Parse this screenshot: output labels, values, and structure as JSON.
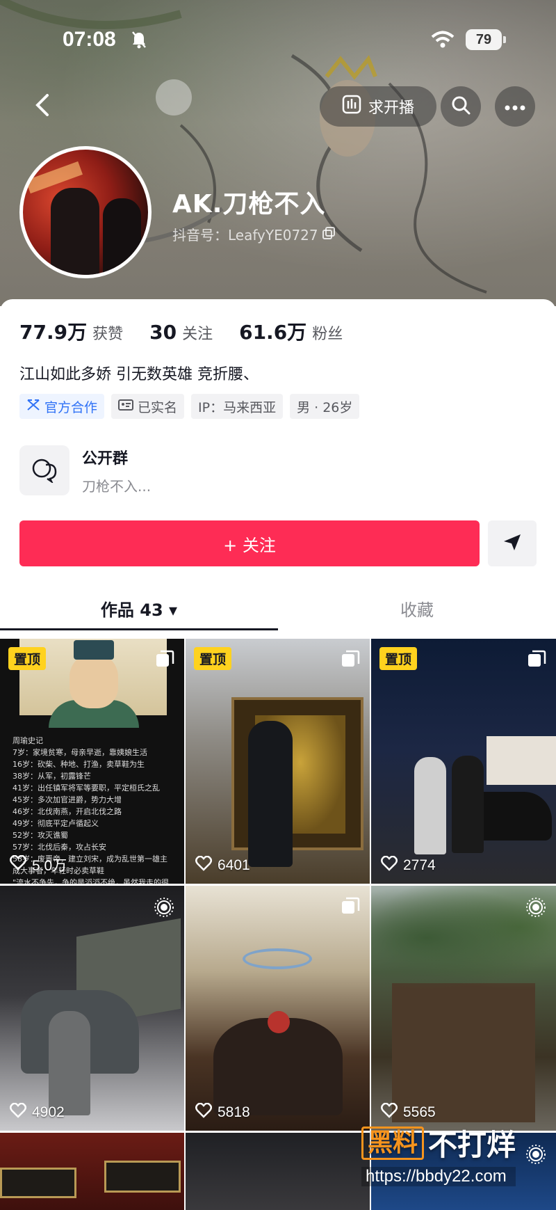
{
  "status_bar": {
    "time": "07:08",
    "battery": "79"
  },
  "header": {
    "live_request_label": "求开播"
  },
  "profile": {
    "name": "AK.刀枪不入",
    "douyin_id": "抖音号：LeafyYE0727",
    "stats": [
      {
        "value": "77.9万",
        "label": "获赞"
      },
      {
        "value": "30",
        "label": "关注"
      },
      {
        "value": "61.6万",
        "label": "粉丝"
      }
    ],
    "bio": "江山如此多娇 引无数英雄 竞折腰、",
    "tags": [
      {
        "text": "官方合作"
      },
      {
        "text": "已实名"
      },
      {
        "text": "IP：马来西亚"
      },
      {
        "text": "男 · 26岁"
      }
    ],
    "group": {
      "title": "公开群",
      "subtitle": "刀枪不入..."
    },
    "follow_label": "+ 关注"
  },
  "tabs": [
    {
      "label": "作品 43 ▾"
    },
    {
      "label": "收藏"
    }
  ],
  "videos": [
    {
      "pinned": "置顶",
      "likes": "5.0万"
    },
    {
      "pinned": "置顶",
      "likes": "6401"
    },
    {
      "pinned": "置顶",
      "likes": "2774"
    },
    {
      "likes": "4902"
    },
    {
      "likes": "5818"
    },
    {
      "likes": "5565"
    }
  ],
  "video1_text": {
    "title": "周瑜史记",
    "lines": [
      "7岁：家境贫寒，母亲早逝，靠姨娘生活",
      "16岁：砍柴、种地、打渔，卖草鞋为生",
      "38岁：从军，初露锋芒",
      "41岁：出任镇军将军等要职，平定桓氏之乱",
      "45岁：多次加官进爵，势力大增",
      "46岁：北伐南燕，开启北伐之路",
      "49岁：彻底平定卢循起义",
      "52岁：攻灭谯蜀",
      "57岁：北伐后秦，攻占长安",
      "58岁：废晋帝，建立刘宋，成为乱世第一雄主",
      "成大事者，年轻时必卖草鞋",
      "\"流水不争先，争的是滔滔不绝，虽然我走的很"
    ]
  },
  "watermark": {
    "brand_box": "黑料",
    "brand_rest": "不打烊",
    "url": "https://bbdy22.com"
  },
  "colors": {
    "primary": "#fe2c55",
    "pin": "#ffd21e",
    "official": "#3072f6"
  }
}
